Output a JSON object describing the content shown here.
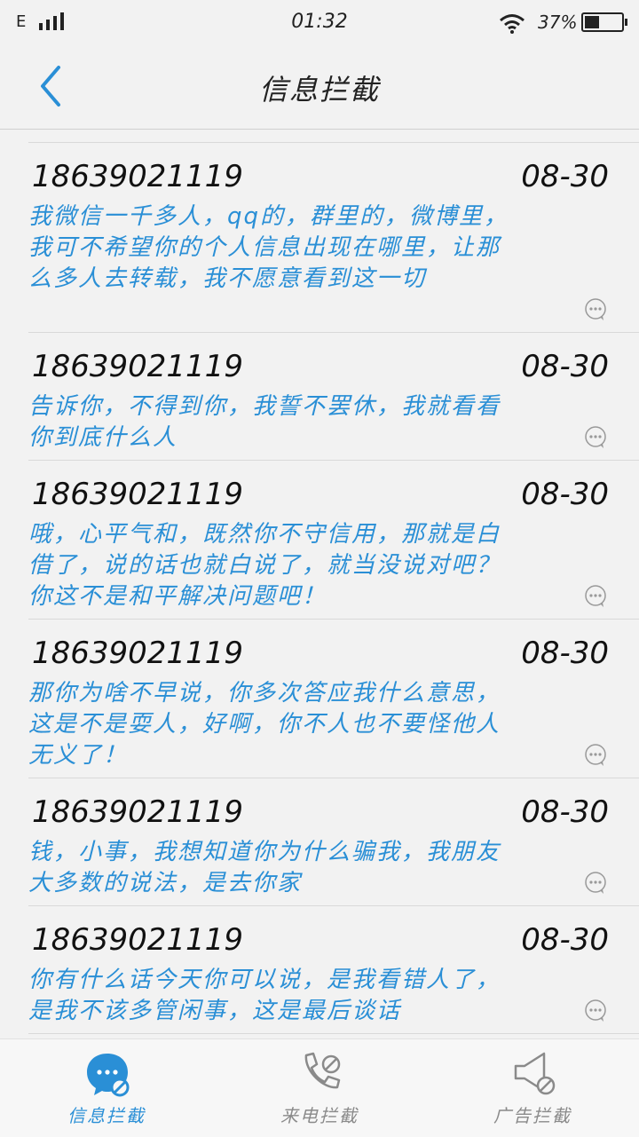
{
  "status_bar": {
    "network": "E",
    "time": "01:32",
    "battery": "37%"
  },
  "header": {
    "title": "信息拦截"
  },
  "messages": [
    {
      "number": "18639021119",
      "date": "08-30",
      "text": "我微信一千多人，qq的，群里的，微博里，我可不希望你的个人信息出现在哪里，让那么多人去转载，我不愿意看到这一切"
    },
    {
      "number": "18639021119",
      "date": "08-30",
      "text": "告诉你，不得到你，我誓不罢休，我就看看你到底什么人"
    },
    {
      "number": "18639021119",
      "date": "08-30",
      "text": "哦，心平气和，既然你不守信用，那就是白借了，说的话也就白说了，就当没说对吧？你这不是和平解决问题吧！"
    },
    {
      "number": "18639021119",
      "date": "08-30",
      "text": "那你为啥不早说，你多次答应我什么意思，这是不是耍人，好啊，你不人也不要怪他人无义了！"
    },
    {
      "number": "18639021119",
      "date": "08-30",
      "text": "钱，小事，我想知道你为什么骗我，我朋友大多数的说法，是去你家"
    },
    {
      "number": "18639021119",
      "date": "08-30",
      "text": "你有什么话今天你可以说，是我看错人了，是我不该多管闲事，这是最后谈话"
    }
  ],
  "bottom_nav": {
    "sms_label": "信息拦截",
    "call_label": "来电拦截",
    "ad_label": "广告拦截"
  },
  "colors": {
    "accent": "#2a8fd6",
    "inactive": "#8a8a8a",
    "background": "#f2f2f2"
  }
}
